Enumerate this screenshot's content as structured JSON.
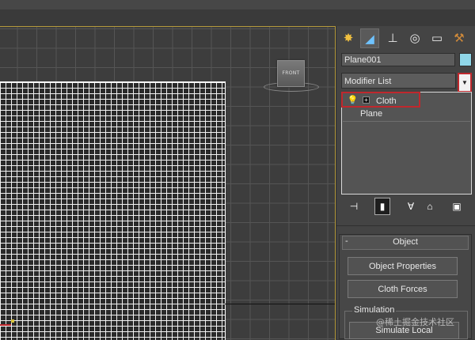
{
  "viewport": {
    "viewcube_label": "FRONT"
  },
  "command_panel": {
    "tabs": [
      {
        "icon": "create-icon",
        "glyph": "✸"
      },
      {
        "icon": "modify-icon",
        "glyph": "◢"
      },
      {
        "icon": "hierarchy-icon",
        "glyph": "⊥"
      },
      {
        "icon": "motion-icon",
        "glyph": "◎"
      },
      {
        "icon": "display-icon",
        "glyph": "▭"
      },
      {
        "icon": "utilities-icon",
        "glyph": "⚒"
      }
    ],
    "object_name": "Plane001",
    "object_color": "#8fd6e8",
    "modifier_list_label": "Modifier List",
    "stack": {
      "items": [
        {
          "label": "Cloth"
        },
        {
          "label": "Plane"
        }
      ]
    },
    "rollout": {
      "title": "Object",
      "collapse_glyph": "-",
      "buttons": {
        "object_properties": "Object Properties",
        "cloth_forces": "Cloth Forces"
      },
      "simulation_group_label": "Simulation",
      "simulate_local": "Simulate Local"
    }
  },
  "watermark": "@稀土掘金技术社区",
  "colors": {
    "highlight_red": "#c0282d",
    "viewport_border": "#b59a3c"
  }
}
